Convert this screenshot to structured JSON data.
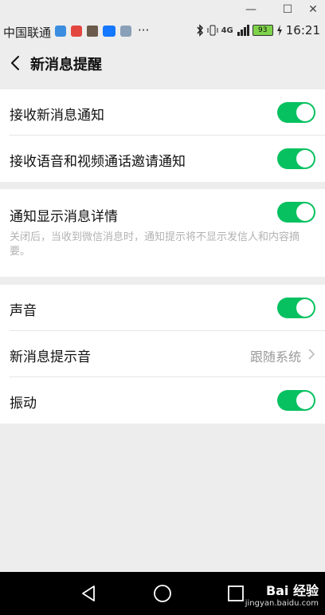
{
  "window_controls": {
    "minimize": "—",
    "restore": "☐",
    "close": "✕"
  },
  "status_bar": {
    "carrier": "中国联通",
    "more": "···",
    "network": "4G",
    "battery": "93",
    "time": "16:21",
    "icons": [
      "notification-app-icon",
      "bluetooth-icon",
      "vibrate-icon",
      "signal-icon",
      "battery-icon"
    ]
  },
  "header": {
    "title": "新消息提醒"
  },
  "group1": {
    "rows": [
      {
        "label": "接收新消息通知",
        "on": true
      },
      {
        "label": "接收语音和视频通话邀请通知",
        "on": true
      }
    ]
  },
  "group2": {
    "label": "通知显示消息详情",
    "on": true,
    "description": "关闭后，当收到微信消息时，通知提示将不显示发信人和内容摘要。"
  },
  "group3": {
    "sound": {
      "label": "声音",
      "on": true
    },
    "ringtone": {
      "label": "新消息提示音",
      "value": "跟随系统"
    },
    "vibrate": {
      "label": "振动",
      "on": true
    }
  },
  "watermark": {
    "main": "Bai 经验",
    "sub": "jingyan.baidu.com"
  },
  "colors": {
    "accent": "#07c160",
    "background": "#ededed",
    "card": "#ffffff"
  }
}
